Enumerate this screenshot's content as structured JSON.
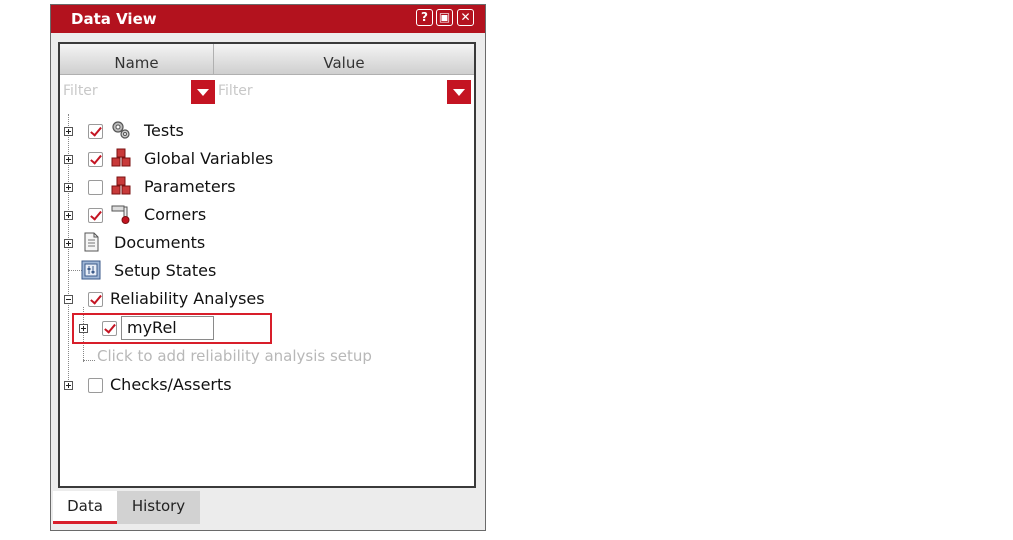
{
  "window": {
    "title": "Data View",
    "buttons": [
      "?",
      "▣",
      "✕"
    ]
  },
  "columns": {
    "name": "Name",
    "value": "Value"
  },
  "filters": {
    "name_placeholder": "Filter",
    "value_placeholder": "Filter"
  },
  "tree": {
    "tests": "Tests",
    "global_variables": "Global Variables",
    "parameters": "Parameters",
    "corners": "Corners",
    "documents": "Documents",
    "setup_states": "Setup States",
    "reliability_analyses": "Reliability Analyses",
    "reliability_child_value": "myRel",
    "add_hint": "Click to add reliability analysis setup",
    "checks_asserts": "Checks/Asserts"
  },
  "tabs": {
    "data": "Data",
    "history": "History"
  },
  "colors": {
    "accent": "#b3121e",
    "check": "#c41422"
  }
}
